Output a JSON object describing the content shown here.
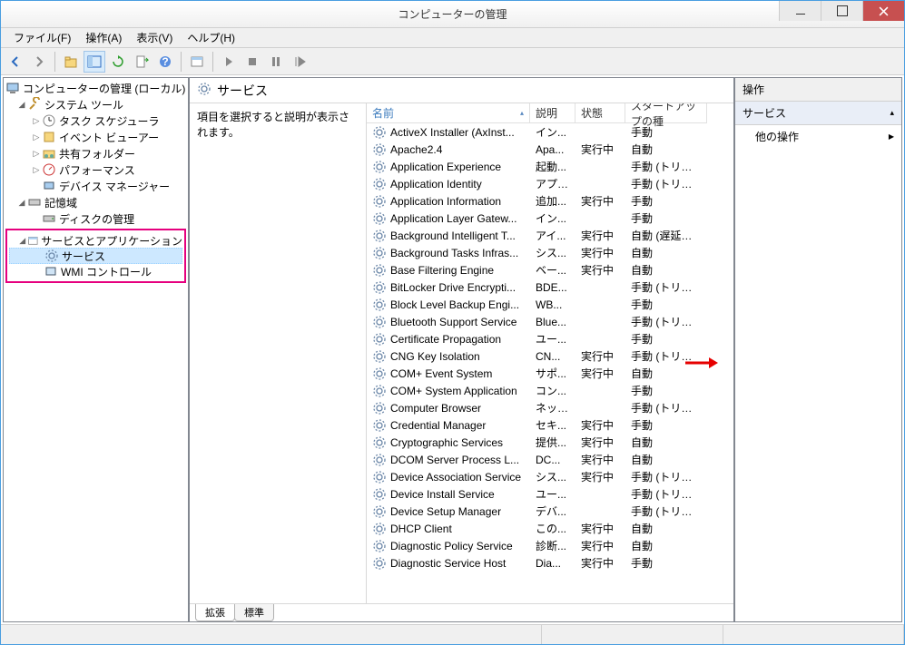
{
  "window": {
    "title": "コンピューターの管理"
  },
  "menu": {
    "file": "ファイル(F)",
    "action": "操作(A)",
    "view": "表示(V)",
    "help": "ヘルプ(H)"
  },
  "tree": {
    "root": "コンピューターの管理 (ローカル)",
    "systools": "システム ツール",
    "task": "タスク スケジューラ",
    "event": "イベント ビューアー",
    "shared": "共有フォルダー",
    "perf": "パフォーマンス",
    "device": "デバイス マネージャー",
    "storage": "記憶域",
    "disk": "ディスクの管理",
    "servapp": "サービスとアプリケーション",
    "services": "サービス",
    "wmi": "WMI コントロール"
  },
  "center": {
    "title": "サービス",
    "desc": "項目を選択すると説明が表示されます。",
    "columns": {
      "name": "名前",
      "desc": "説明",
      "status": "状態",
      "startup": "スタートアップの種"
    },
    "tab_ext": "拡張",
    "tab_std": "標準"
  },
  "services": [
    {
      "name": "ActiveX Installer (AxInst...",
      "desc": "イン...",
      "status": "",
      "startup": "手動"
    },
    {
      "name": "Apache2.4",
      "desc": "Apa...",
      "status": "実行中",
      "startup": "自動"
    },
    {
      "name": "Application Experience",
      "desc": "起動...",
      "status": "",
      "startup": "手動 (トリガー開"
    },
    {
      "name": "Application Identity",
      "desc": "アプリ...",
      "status": "",
      "startup": "手動 (トリガー開"
    },
    {
      "name": "Application Information",
      "desc": "追加...",
      "status": "実行中",
      "startup": "手動"
    },
    {
      "name": "Application Layer Gatew...",
      "desc": "イン...",
      "status": "",
      "startup": "手動"
    },
    {
      "name": "Background Intelligent T...",
      "desc": "アイ...",
      "status": "実行中",
      "startup": "自動 (遅延開始"
    },
    {
      "name": "Background Tasks Infras...",
      "desc": "シス...",
      "status": "実行中",
      "startup": "自動"
    },
    {
      "name": "Base Filtering Engine",
      "desc": "ベー...",
      "status": "実行中",
      "startup": "自動"
    },
    {
      "name": "BitLocker Drive Encrypti...",
      "desc": "BDE...",
      "status": "",
      "startup": "手動 (トリガー開"
    },
    {
      "name": "Block Level Backup Engi...",
      "desc": "WB...",
      "status": "",
      "startup": "手動"
    },
    {
      "name": "Bluetooth Support Service",
      "desc": "Blue...",
      "status": "",
      "startup": "手動 (トリガー開"
    },
    {
      "name": "Certificate Propagation",
      "desc": "ユー...",
      "status": "",
      "startup": "手動"
    },
    {
      "name": "CNG Key Isolation",
      "desc": "CN...",
      "status": "実行中",
      "startup": "手動 (トリガー開"
    },
    {
      "name": "COM+ Event System",
      "desc": "サポ...",
      "status": "実行中",
      "startup": "自動"
    },
    {
      "name": "COM+ System Application",
      "desc": "コン...",
      "status": "",
      "startup": "手動"
    },
    {
      "name": "Computer Browser",
      "desc": "ネット...",
      "status": "",
      "startup": "手動 (トリガー開"
    },
    {
      "name": "Credential Manager",
      "desc": "セキ...",
      "status": "実行中",
      "startup": "手動"
    },
    {
      "name": "Cryptographic Services",
      "desc": "提供...",
      "status": "実行中",
      "startup": "自動"
    },
    {
      "name": "DCOM Server Process L...",
      "desc": "DC...",
      "status": "実行中",
      "startup": "自動"
    },
    {
      "name": "Device Association Service",
      "desc": "シス...",
      "status": "実行中",
      "startup": "手動 (トリガー開"
    },
    {
      "name": "Device Install Service",
      "desc": "ユー...",
      "status": "",
      "startup": "手動 (トリガー開"
    },
    {
      "name": "Device Setup Manager",
      "desc": "デバ...",
      "status": "",
      "startup": "手動 (トリガー開"
    },
    {
      "name": "DHCP Client",
      "desc": "この...",
      "status": "実行中",
      "startup": "自動"
    },
    {
      "name": "Diagnostic Policy Service",
      "desc": "診断...",
      "status": "実行中",
      "startup": "自動"
    },
    {
      "name": "Diagnostic Service Host",
      "desc": "Dia...",
      "status": "実行中",
      "startup": "手動"
    }
  ],
  "actions": {
    "header": "操作",
    "services": "サービス",
    "other": "他の操作"
  }
}
